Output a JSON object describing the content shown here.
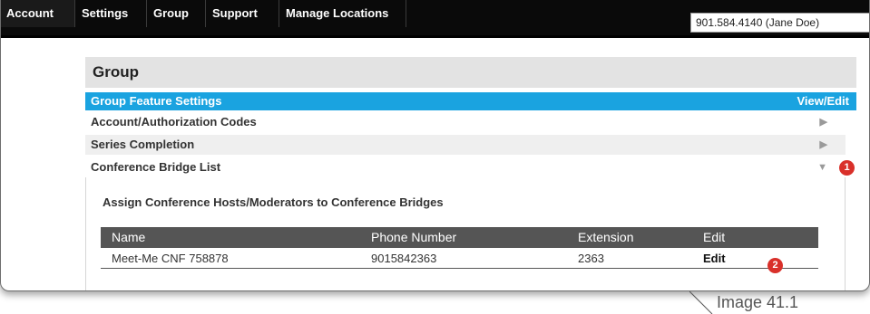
{
  "nav": {
    "items": [
      {
        "label": "Account"
      },
      {
        "label": "Settings"
      },
      {
        "label": "Group"
      },
      {
        "label": "Support"
      },
      {
        "label": "Manage Locations"
      }
    ],
    "user_selector": "901.584.4140 (Jane Doe)"
  },
  "panel": {
    "title": "Group",
    "feature_bar": {
      "label": "Group Feature Settings",
      "action": "View/Edit"
    },
    "rows": [
      {
        "label": "Account/Authorization Codes",
        "arrow": "collapsed"
      },
      {
        "label": "Series Completion",
        "arrow": "collapsed"
      },
      {
        "label": "Conference Bridge List",
        "arrow": "expanded"
      }
    ],
    "badges": [
      "1",
      "2"
    ],
    "conference": {
      "title": "Assign Conference Hosts/Moderators to Conference Bridges",
      "columns": [
        "Name",
        "Phone Number",
        "Extension",
        "Edit"
      ],
      "rows": [
        {
          "name": "Meet-Me CNF 758878",
          "phone": "9015842363",
          "extension": "2363",
          "edit": "Edit"
        }
      ]
    }
  },
  "caption": "Image 41.1",
  "colors": {
    "accent": "#1aa3e0",
    "badge": "#d9302a",
    "table_header": "#555555"
  }
}
